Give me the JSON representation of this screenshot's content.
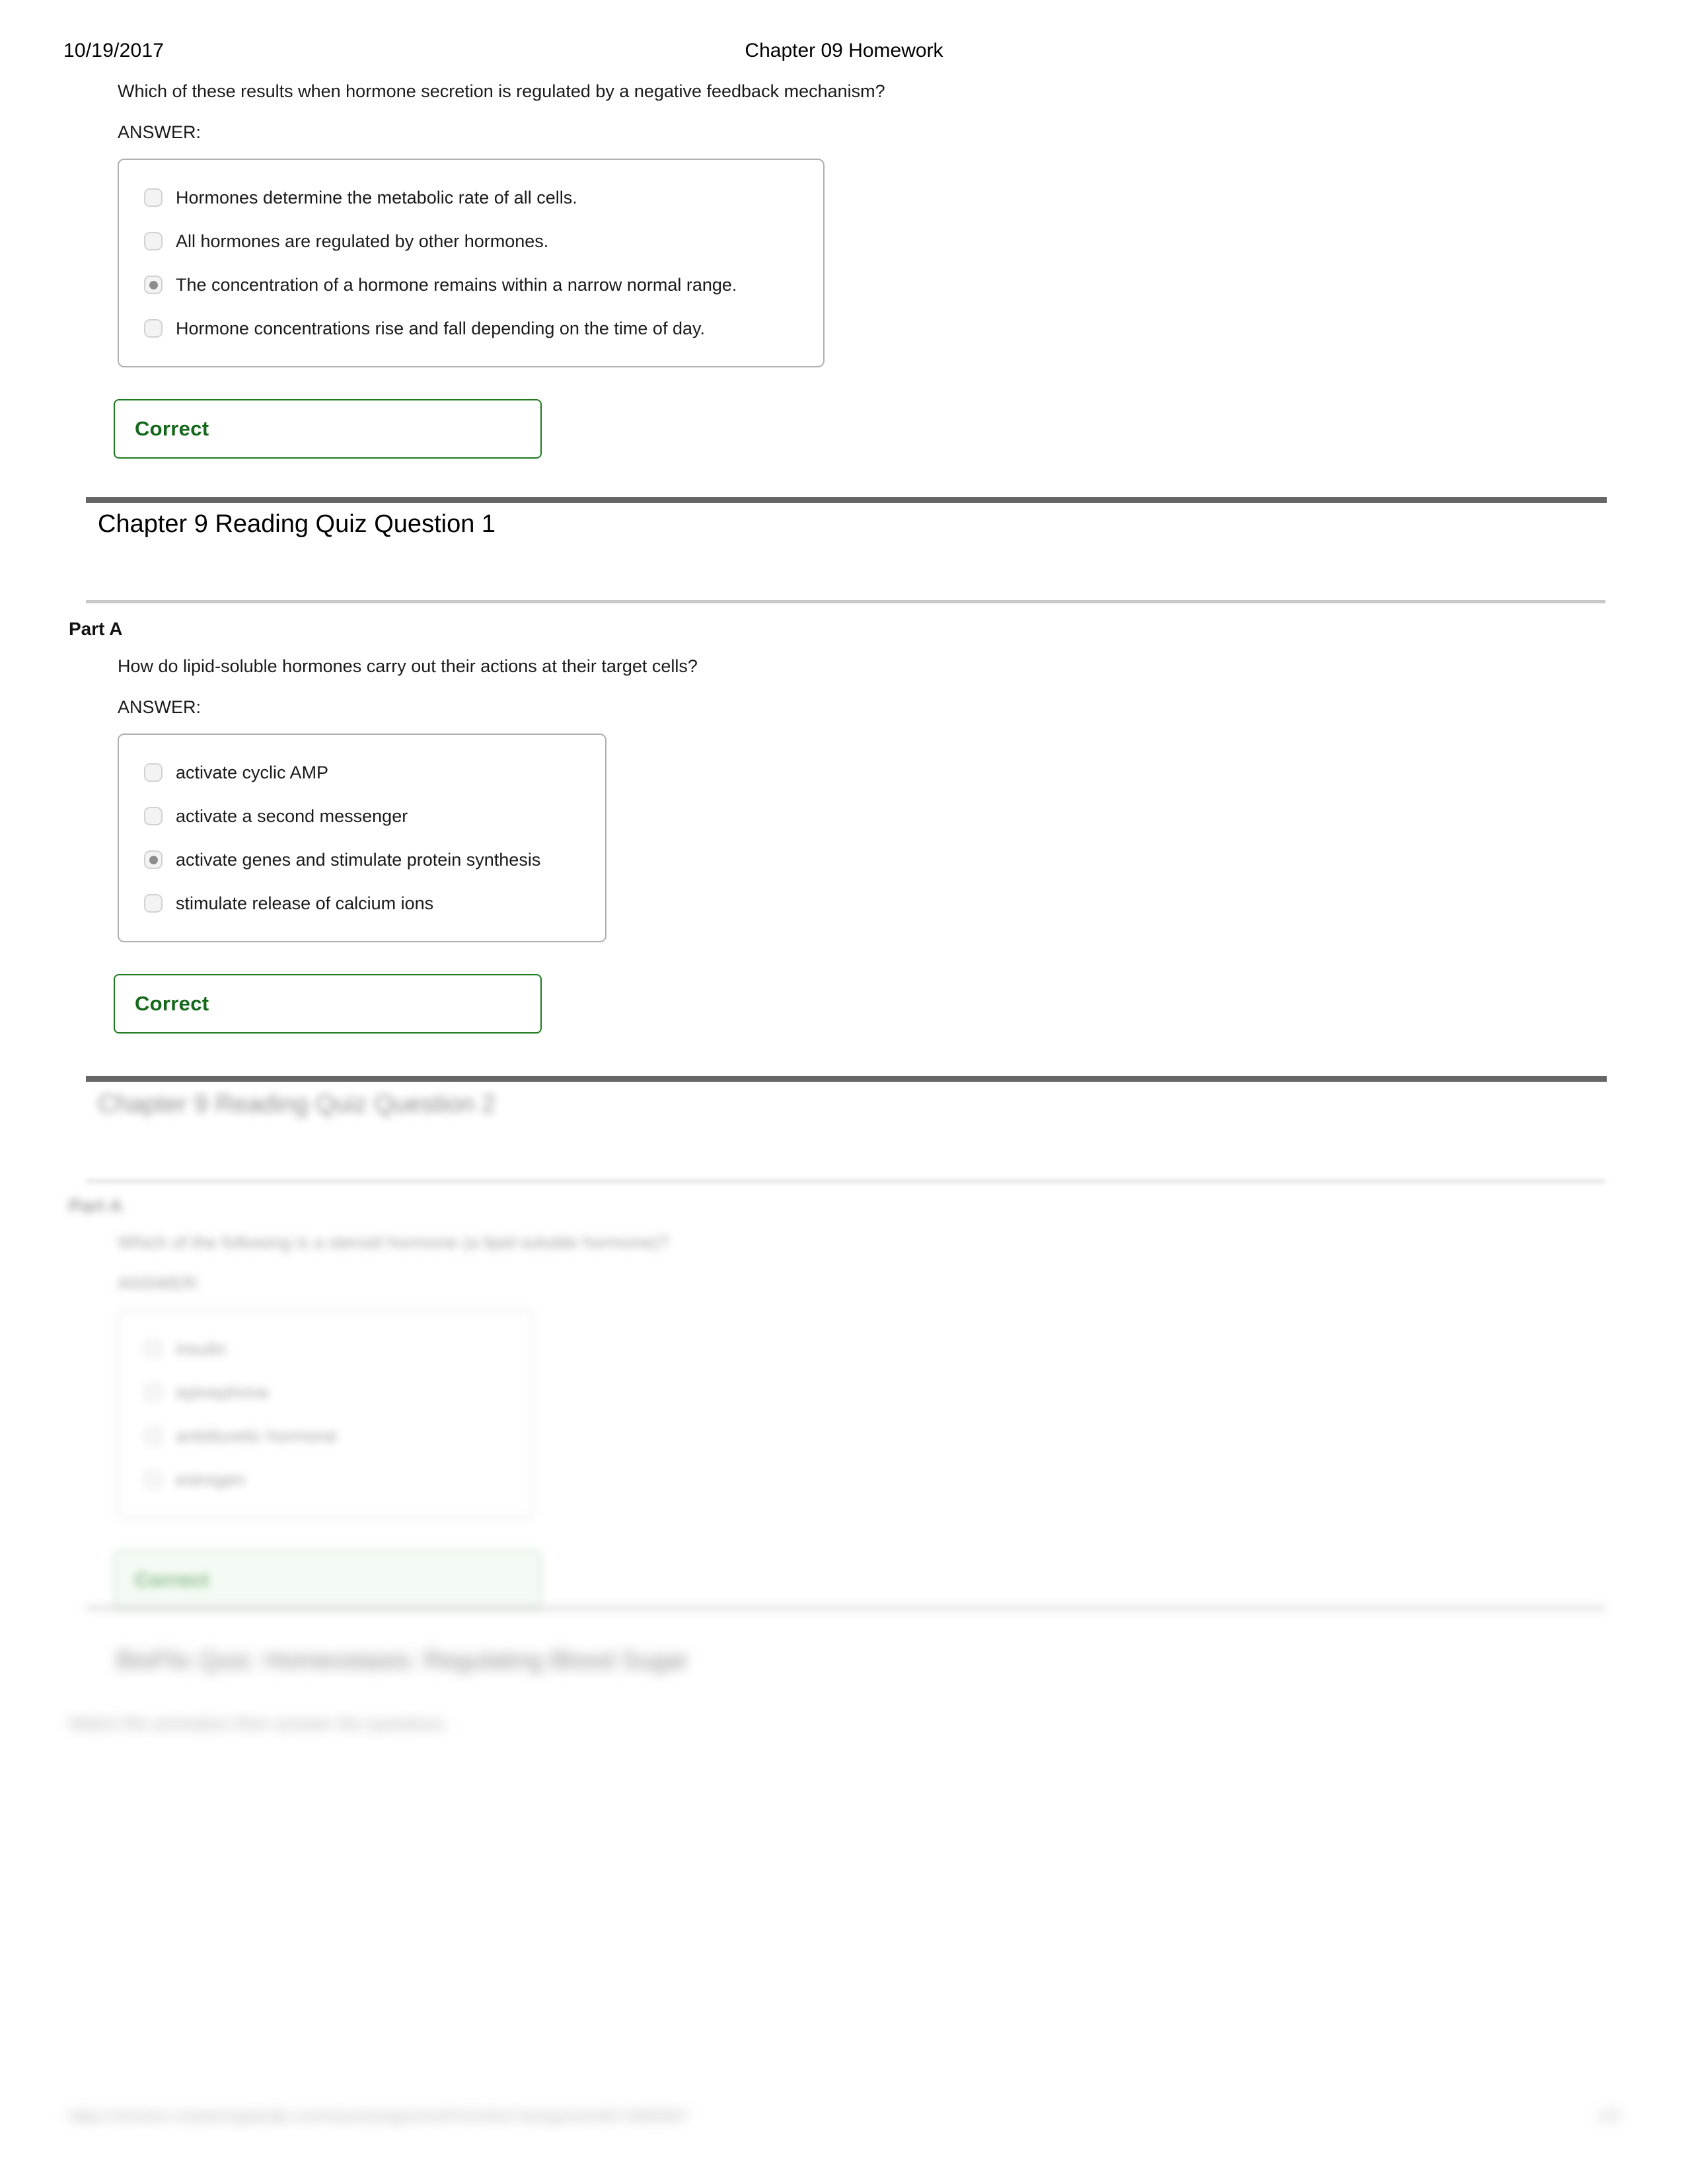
{
  "page": {
    "header": {
      "date": "10/19/2017",
      "title": "Chapter 09 Homework"
    },
    "footer": {
      "url": "https://session.masteringaandp.com/myct/assignmentPrintView?assignmentID=5692607",
      "page_indicator": "1/3"
    }
  },
  "questions": [
    {
      "id": "q-top",
      "stem": "Which of these results when hormone secretion is regulated by a negative feedback mechanism?",
      "answer_label": "ANSWER:",
      "options": [
        {
          "text": "Hormones determine the metabolic rate of all cells.",
          "selected": false
        },
        {
          "text": "All hormones are regulated by other hormones.",
          "selected": false
        },
        {
          "text": "The concentration of a hormone remains within a narrow normal range.",
          "selected": true
        },
        {
          "text": "Hormone concentrations rise and fall depending on the time of day.",
          "selected": false
        }
      ],
      "result": "Correct"
    }
  ],
  "sections": [
    {
      "id": "section-quiz-1",
      "title": "Chapter 9 Reading Quiz Question 1",
      "part_label": "Part A",
      "stem": "How do lipid-soluble hormones carry out their actions at their target cells?",
      "answer_label": "ANSWER:",
      "options": [
        {
          "text": "activate cyclic AMP",
          "selected": false
        },
        {
          "text": "activate a second messenger",
          "selected": false
        },
        {
          "text": "activate genes and stimulate protein synthesis",
          "selected": true
        },
        {
          "text": "stimulate release of calcium ions",
          "selected": false
        }
      ],
      "result": "Correct"
    },
    {
      "id": "section-quiz-2",
      "blurred": true,
      "title": "Chapter 9 Reading Quiz Question 2",
      "part_label": "Part A",
      "stem": "Which of the following is a steroid hormone (a lipid-soluble hormone)?",
      "answer_label": "ANSWER:",
      "options": [
        {
          "text": "insulin",
          "selected": false
        },
        {
          "text": "epinephrine",
          "selected": false
        },
        {
          "text": "antidiuretic hormone",
          "selected": false
        },
        {
          "text": "estrogen",
          "selected": false
        }
      ],
      "result": "Correct"
    },
    {
      "id": "section-bioflix",
      "blurred": true,
      "title": "BioFlix Quiz: Homeostasis: Regulating Blood Sugar",
      "subtitle": "Watch the animation then answer the questions."
    }
  ]
}
